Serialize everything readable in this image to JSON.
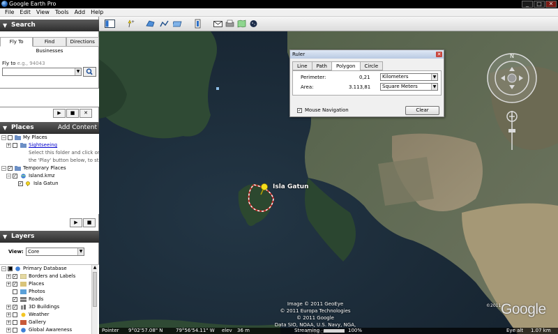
{
  "window": {
    "title": "Google Earth Pro",
    "controls": [
      "_",
      "□",
      "✕"
    ]
  },
  "menu": [
    "File",
    "Edit",
    "View",
    "Tools",
    "Add",
    "Help"
  ],
  "search": {
    "header": "Search",
    "tabs": [
      "Fly To",
      "Find Businesses",
      "Directions"
    ],
    "flyto_label": "Fly to",
    "flyto_hint": "e.g., 94043"
  },
  "places": {
    "header": "Places",
    "add_content": "Add Content",
    "items": {
      "my_places": "My Places",
      "sightseeing": "Sightseeing",
      "desc1": "Select this folder and click on",
      "desc2": "the 'Play' button below, to start th",
      "temporary": "Temporary Places",
      "island_kmz": "Island.kmz",
      "isla_gatun": "Isla Gatun"
    }
  },
  "layers": {
    "header": "Layers",
    "view_label": "View:",
    "view_value": "Core",
    "items": [
      "Primary Database",
      "Borders and Labels",
      "Places",
      "Photos",
      "Roads",
      "3D Buildings",
      "Weather",
      "Gallery",
      "Global Awareness"
    ]
  },
  "ruler": {
    "title": "Ruler",
    "tabs": [
      "Line",
      "Path",
      "Polygon",
      "Circle"
    ],
    "perimeter_label": "Perimeter:",
    "perimeter_value": "0,21",
    "perimeter_unit": "Kilometers",
    "area_label": "Area:",
    "area_value": "3.113,81",
    "area_unit": "Square Meters",
    "mouse_nav": "Mouse Navigation",
    "clear": "Clear"
  },
  "map": {
    "placemark": "Isla Gatun",
    "copyright": [
      "Image © 2011 GeoEye",
      "© 2011 Europa Technologies",
      "© 2011 Google",
      "Data SIO, NOAA, U.S. Navy, NGA, GEBCO"
    ],
    "logo": "Google",
    "logo_year": "©2011"
  },
  "status": {
    "pointer_label": "Pointer",
    "lat": "9°02'57.08\" N",
    "lon": "79°56'54.11\" W",
    "elev_label": "elev",
    "elev": "36 m",
    "streaming_label": "Streaming",
    "streaming_pct": "100%",
    "eye_label": "Eye alt",
    "eye_alt": "1.07 km"
  },
  "colors": {
    "accent": "#2a6fc9",
    "water": "#1c2c3a"
  }
}
